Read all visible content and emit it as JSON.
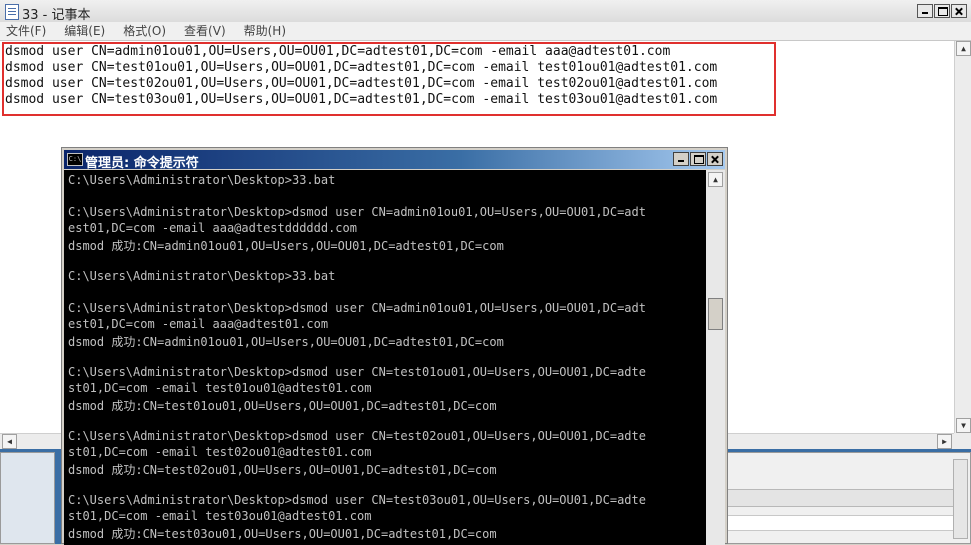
{
  "notepad": {
    "title": "33 - 记事本",
    "menu": [
      "文件(F)",
      "编辑(E)",
      "格式(O)",
      "查看(V)",
      "帮助(H)"
    ],
    "lines": [
      "dsmod user CN=admin01ou01,OU=Users,OU=OU01,DC=adtest01,DC=com -email aaa@adtest01.com",
      "dsmod user CN=test01ou01,OU=Users,OU=OU01,DC=adtest01,DC=com -email test01ou01@adtest01.com",
      "dsmod user CN=test02ou01,OU=Users,OU=OU01,DC=adtest01,DC=com -email test02ou01@adtest01.com",
      "dsmod user CN=test03ou01,OU=Users,OU=OU01,DC=adtest01,DC=com -email test03ou01@adtest01.com"
    ]
  },
  "cmd": {
    "title": "管理员: 命令提示符",
    "icon_label": "C:\\",
    "lines": [
      "C:\\Users\\Administrator\\Desktop>33.bat",
      "",
      "C:\\Users\\Administrator\\Desktop>dsmod user CN=admin01ou01,OU=Users,OU=OU01,DC=adt",
      "est01,DC=com -email aaa@adtestdddddd.com",
      "dsmod 成功:CN=admin01ou01,OU=Users,OU=OU01,DC=adtest01,DC=com",
      "",
      "C:\\Users\\Administrator\\Desktop>33.bat",
      "",
      "C:\\Users\\Administrator\\Desktop>dsmod user CN=admin01ou01,OU=Users,OU=OU01,DC=adt",
      "est01,DC=com -email aaa@adtest01.com",
      "dsmod 成功:CN=admin01ou01,OU=Users,OU=OU01,DC=adtest01,DC=com",
      "",
      "C:\\Users\\Administrator\\Desktop>dsmod user CN=test01ou01,OU=Users,OU=OU01,DC=adte",
      "st01,DC=com -email test01ou01@adtest01.com",
      "dsmod 成功:CN=test01ou01,OU=Users,OU=OU01,DC=adtest01,DC=com",
      "",
      "C:\\Users\\Administrator\\Desktop>dsmod user CN=test02ou01,OU=Users,OU=OU01,DC=adte",
      "st01,DC=com -email test02ou01@adtest01.com",
      "dsmod 成功:CN=test02ou01,OU=Users,OU=OU01,DC=adtest01,DC=com",
      "",
      "C:\\Users\\Administrator\\Desktop>dsmod user CN=test03ou01,OU=Users,OU=OU01,DC=adte",
      "st01,DC=com -email test03ou01@adtest01.com",
      "dsmod 成功:CN=test03ou01,OU=Users,OU=OU01,DC=adtest01,DC=com"
    ]
  },
  "icons": {
    "up_arrow": "▲",
    "down_arrow": "▼",
    "left_arrow": "◀",
    "right_arrow": "▶"
  },
  "colors": {
    "highlight_box": "#e0302e",
    "console_bg": "#000000",
    "console_text": "#c0c0c0"
  }
}
